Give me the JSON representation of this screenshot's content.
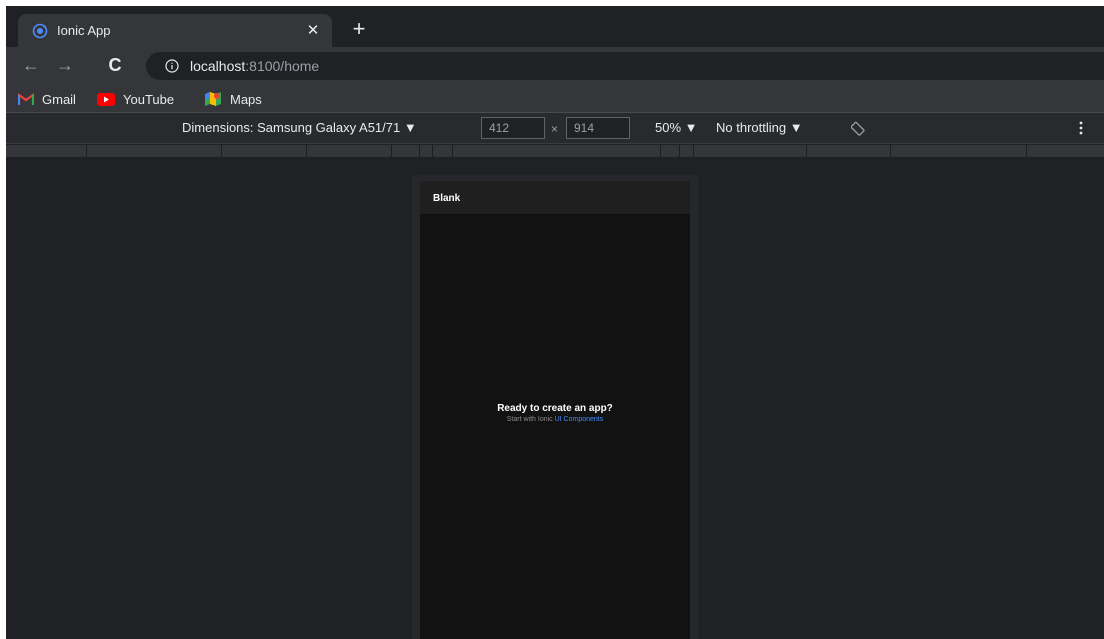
{
  "tab": {
    "title": "Ionic App",
    "close": "✕",
    "new_tab": "+"
  },
  "toolbar": {
    "back": "←",
    "forward": "→",
    "reload": "C",
    "url_host": "localhost",
    "url_rest": ":8100/home"
  },
  "bookmarks": [
    {
      "label": "Gmail"
    },
    {
      "label": "YouTube"
    },
    {
      "label": "Maps"
    }
  ],
  "device_toolbar": {
    "dimensions": "Dimensions: Samsung Galaxy A51/71 ▼",
    "width": "412",
    "times": "×",
    "height": "914",
    "zoom": "50% ▼",
    "throttling": "No throttling ▼"
  },
  "app": {
    "header_title": "Blank",
    "ready_title": "Ready to create an app?",
    "ready_prefix": "Start with Ionic ",
    "ready_link": "UI Components"
  },
  "colors": {
    "link": "#428cff",
    "frame_bg": "#202124",
    "toolbar_bg": "#35363a"
  }
}
